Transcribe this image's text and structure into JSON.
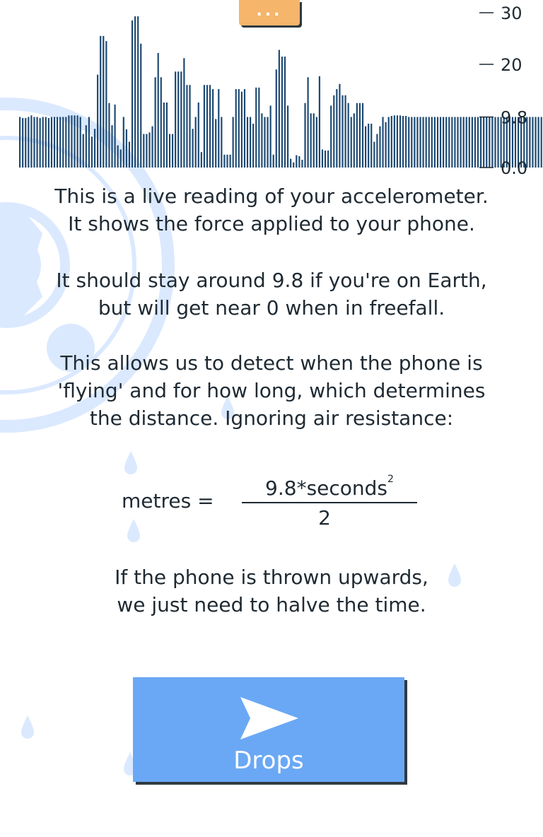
{
  "menu": {
    "label": "..."
  },
  "chart_data": {
    "type": "bar",
    "y_ticks": [
      "30",
      "20",
      "9.8",
      "0.0"
    ],
    "ylim": [
      0,
      30
    ],
    "values": [
      9.8,
      9.6,
      9.6,
      9.8,
      10.1,
      9.8,
      9.8,
      9.6,
      9.8,
      9.8,
      9.6,
      9.8,
      9.8,
      9.8,
      9.8,
      9.8,
      9.8,
      10.1,
      10.1,
      10.1,
      10.1,
      9.8,
      6.5,
      8.2,
      9.8,
      6,
      7.5,
      18,
      25.5,
      25.5,
      24.5,
      12.5,
      8.2,
      12.2,
      4.3,
      3.5,
      9.8,
      7.4,
      5,
      28.5,
      29.3,
      29.3,
      24,
      6.5,
      6.5,
      6.8,
      8,
      17.5,
      22.2,
      17.5,
      12.6,
      12.6,
      6.5,
      6.5,
      18.6,
      18.6,
      18.6,
      21.2,
      16,
      16,
      7.5,
      9.8,
      12.6,
      3,
      16,
      16,
      16,
      15.2,
      9.4,
      15.2,
      9.8,
      2.5,
      2.5,
      2.5,
      9.8,
      15.2,
      15.2,
      14.7,
      15.2,
      9.8,
      9.8,
      8.5,
      15.5,
      15.5,
      10.5,
      9.8,
      9.8,
      12,
      2.5,
      19,
      22.8,
      21.5,
      21.5,
      12,
      1.7,
      1,
      2.4,
      2.2,
      1.5,
      12.5,
      17.5,
      10.5,
      10.5,
      9.8,
      17.7,
      3.5,
      3.3,
      3.3,
      12,
      14,
      15.2,
      16.2,
      14,
      14,
      12.5,
      9.8,
      10.5,
      12.5,
      12.5,
      12.5,
      8,
      8.5,
      8.5,
      5,
      6.5,
      8,
      9.8,
      8.8,
      9.8,
      10,
      10.1,
      10.1,
      10.1,
      10,
      10,
      9.8,
      9.8,
      9.8,
      9.8,
      9.8,
      9.8,
      9.8,
      9.8,
      9.8,
      9.8,
      9.8,
      9.8,
      9.8,
      9.8,
      9.8,
      9.8,
      9.8,
      9.8,
      9.8,
      9.8,
      9.8,
      9.8,
      9.8,
      9.8,
      9.8,
      9.8,
      9.8,
      9.8,
      9.8,
      9.8,
      9.8,
      9.8,
      9.8,
      9.8,
      9.8,
      9.8,
      9.8,
      9.8,
      9.8,
      9.8,
      9.8,
      9.8,
      9.8,
      9.8,
      9.8,
      9.8,
      9.8,
      9.8,
      9.8,
      9.8,
      9.8,
      9.8,
      9.8,
      9.8
    ],
    "bar_color": "#1e4a73"
  },
  "explanation": {
    "p1": [
      "This is a live reading of your accelerometer.",
      "It shows the force applied to your phone."
    ],
    "p2": [
      "It should stay around 9.8 if you're on Earth,",
      "but will get near 0 when in freefall."
    ],
    "p3": [
      "This allows us to detect when the phone is",
      "'flying' and for how long, which determines",
      "the distance. Ignoring air resistance:"
    ]
  },
  "formula": {
    "lhs": "metres =",
    "numerator": "9.8*seconds",
    "exponent": "2",
    "denominator": "2"
  },
  "note": [
    "If the phone is thrown upwards,",
    "we just need to halve the time."
  ],
  "drops_button": {
    "label": "Drops"
  },
  "colors": {
    "accent": "#6aa8f5",
    "menu": "#f5b56a",
    "text": "#1f2a33",
    "decoration": "#dbe9ff"
  }
}
